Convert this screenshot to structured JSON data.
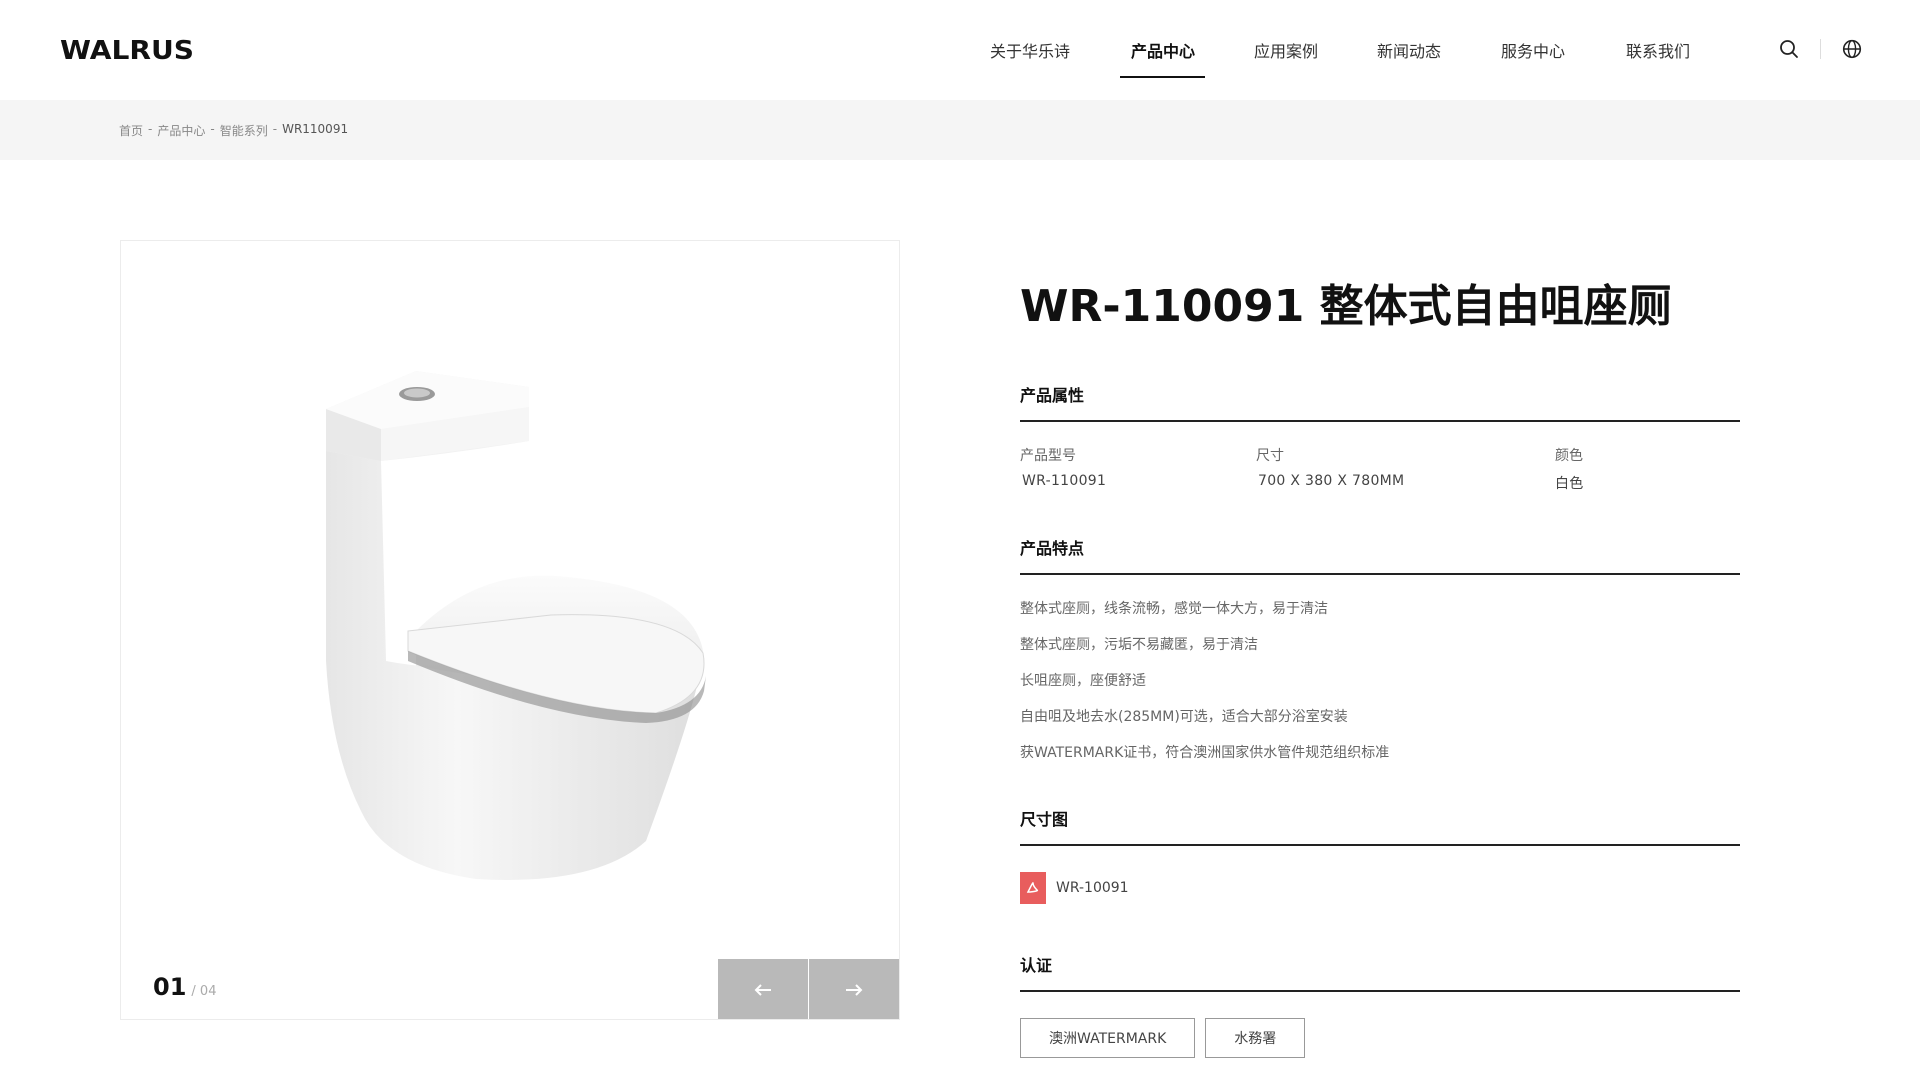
{
  "header": {
    "logo": "WALRUS",
    "nav": [
      {
        "label": "关于华乐诗",
        "active": false
      },
      {
        "label": "产品中心",
        "active": true
      },
      {
        "label": "应用案例",
        "active": false
      },
      {
        "label": "新闻动态",
        "active": false
      },
      {
        "label": "服务中心",
        "active": false
      },
      {
        "label": "联系我们",
        "active": false
      }
    ],
    "icons": [
      "search-icon",
      "globe-icon"
    ]
  },
  "breadcrumb": {
    "items": [
      "首页",
      "产品中心",
      "智能系列"
    ],
    "separator": "-",
    "current": "WR110091"
  },
  "gallery": {
    "current": "01",
    "total": "/ 04",
    "prev_icon": "arrow-left-icon",
    "next_icon": "arrow-right-icon"
  },
  "product": {
    "title": "WR-110091 整体式自由咀座厕",
    "attributes_heading": "产品属性",
    "attributes": [
      {
        "label": "产品型号",
        "value": "WR-110091"
      },
      {
        "label": "尺寸",
        "value": "700 X 380 X 780MM"
      },
      {
        "label": "颜色",
        "value": "白色"
      }
    ],
    "features_heading": "产品特点",
    "features": [
      "整体式座厕，线条流畅，感觉一体大方，易于清洁",
      "整体式座厕，污垢不易藏匿，易于清洁",
      "长咀座厕，座便舒适",
      "自由咀及地去水(285MM)可选，适合大部分浴室安装",
      "获WATERMARK证书，符合澳洲国家供水管件规范组织标准"
    ],
    "drawing_heading": "尺寸图",
    "drawing_file": "WR-10091",
    "cert_heading": "认证",
    "certs": [
      "澳洲WATERMARK",
      "水務署"
    ]
  },
  "colors": {
    "accent": "#111111",
    "pdf": "#e85d5d",
    "gallery_button": "#b9b9b9",
    "breadcrumb_bg": "#f5f5f5"
  }
}
